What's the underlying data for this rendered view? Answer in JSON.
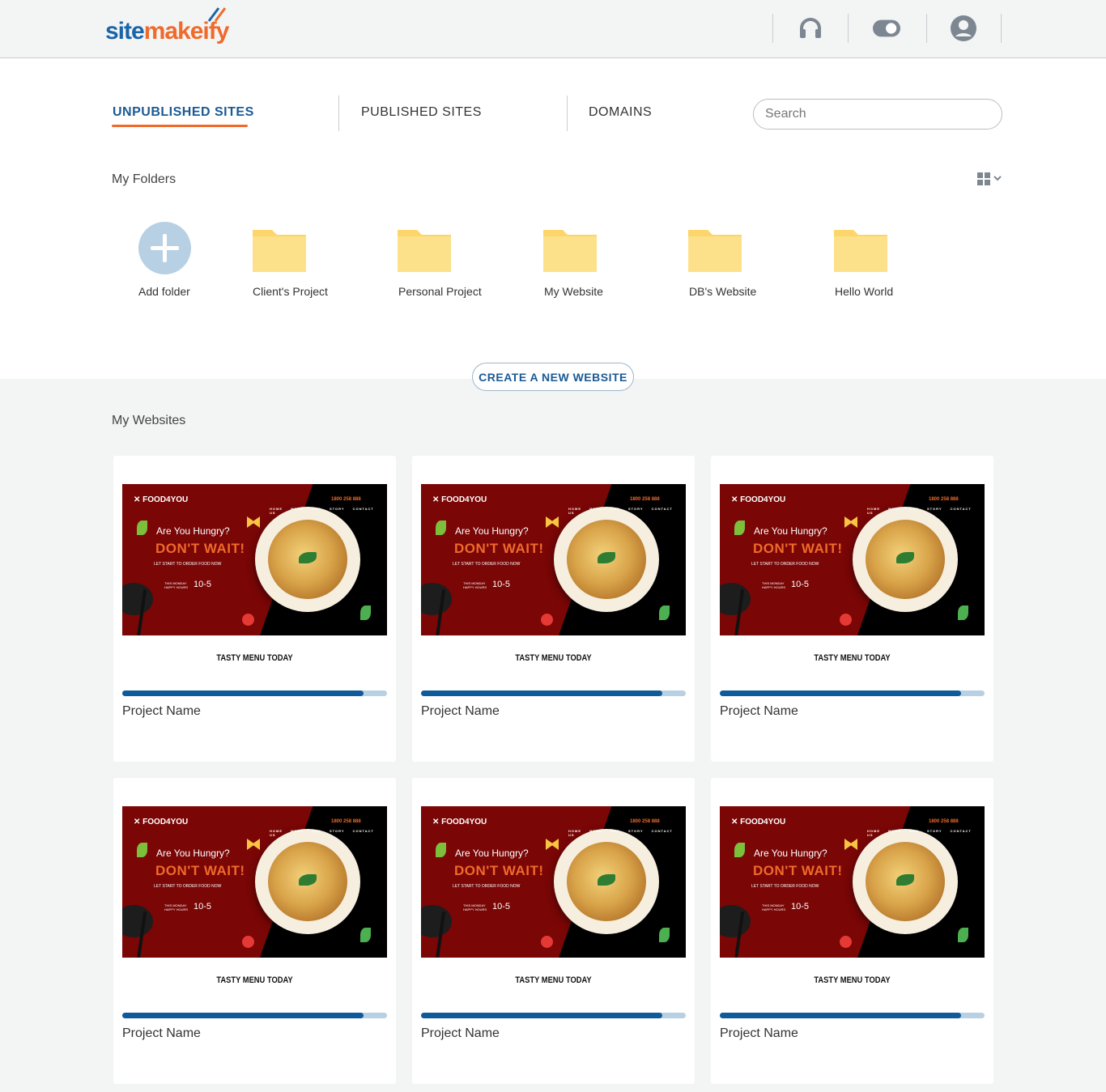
{
  "header": {
    "logo_site": "site",
    "logo_make": "makeify",
    "icons": [
      "headset-icon",
      "toggle-icon",
      "user-icon"
    ]
  },
  "tabs": [
    {
      "label": "UNPUBLISHED SITES",
      "active": true
    },
    {
      "label": "PUBLISHED SITES",
      "active": false
    },
    {
      "label": "DOMAINS",
      "active": false
    }
  ],
  "search": {
    "placeholder": "Search",
    "value": ""
  },
  "folders_section": {
    "title": "My Folders",
    "add_label": "Add folder",
    "items": [
      "Client's Project",
      "Personal Project",
      "My Website",
      "DB's Website",
      "Hello World"
    ]
  },
  "create_button": "CREATE A NEW WEBSITE",
  "websites_section": {
    "title": "My Websites",
    "cards": [
      {
        "name": "Project Name",
        "progress": 0.91
      },
      {
        "name": "Project Name",
        "progress": 0.91
      },
      {
        "name": "Project Name",
        "progress": 0.91
      },
      {
        "name": "Project Name",
        "progress": 0.91
      },
      {
        "name": "Project Name",
        "progress": 0.91
      },
      {
        "name": "Project Name",
        "progress": 0.91
      }
    ]
  },
  "thumbnail": {
    "brand": "✕ FOOD4YOU",
    "nav": "HOME MENU OUR STORY CONTACT US",
    "phone": "1800 258 888",
    "headline": "Are You Hungry?",
    "cta": "DON'T WAIT!",
    "sub": "LET START TO ORDER FOOD NOW",
    "hours_label": "THIS MONDAY HAPPY HOURS",
    "hours": "10-5",
    "tagline": "TASTY MENU TODAY"
  },
  "colors": {
    "brand_blue": "#1a64a8",
    "brand_orange": "#ef6a2b",
    "progress_fill": "#0f5a9a",
    "progress_track": "#b7d0e3",
    "folder": "#fcd66b"
  }
}
